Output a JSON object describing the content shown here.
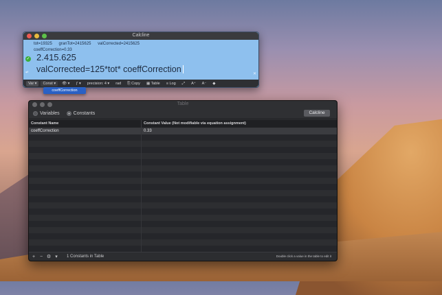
{
  "calcline": {
    "title": "Calcline",
    "vars_line1": [
      "tot=19325",
      "granTot=2415625",
      "valCorrected=2415625"
    ],
    "vars_line2": "coeffCorrection=0.33",
    "result": "2.415.625",
    "expression": "valCorrected=125*tot* coeffCorrection",
    "toolbar": {
      "var": "Var",
      "const": "Const",
      "precision": "precision: 4",
      "rad": "rad",
      "copy": "Copy",
      "table": "Table",
      "log": "Log"
    },
    "dropdown_item": "coeffCorrection"
  },
  "table": {
    "title": "Table",
    "tab_variables": "Variables",
    "tab_constants": "Constants",
    "calcline_button": "Calcline",
    "columns": [
      "Constant Name",
      "Constant Value  (Not modifiable via equation assignment)"
    ],
    "rows": [
      [
        "coeffCorrection",
        "0.33"
      ]
    ],
    "footer_count": "1 Constants in Table",
    "footer_hint": "Double click a value in the table to edit it"
  }
}
